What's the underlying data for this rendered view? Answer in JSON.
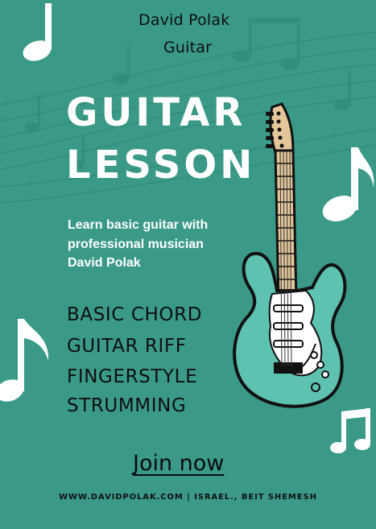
{
  "header": {
    "name": "David Polak",
    "subtitle": "Guitar"
  },
  "title": {
    "line1": "GUITAR",
    "line2": "LESSON"
  },
  "intro": {
    "line1": "Learn basic guitar with",
    "line2": "professional musician",
    "line3": "David Polak"
  },
  "topics": [
    "BASIC CHORD",
    "GUITAR RIFF",
    "FINGERSTYLE",
    "STRUMMING"
  ],
  "cta": {
    "label": "Join now"
  },
  "footer": {
    "text": "WWW.DAVIDPOLAK.COM | ISRAEL., BEIT SHEMESH"
  },
  "colors": {
    "background": "#3a9a87",
    "guitar_body": "#5ec2b0",
    "text_dark": "#0e0e0e",
    "text_light": "#ffffff"
  },
  "icons": [
    "music-note-icon",
    "eighth-note-icon",
    "beamed-notes-icon",
    "electric-guitar-icon",
    "music-staff-icon"
  ]
}
